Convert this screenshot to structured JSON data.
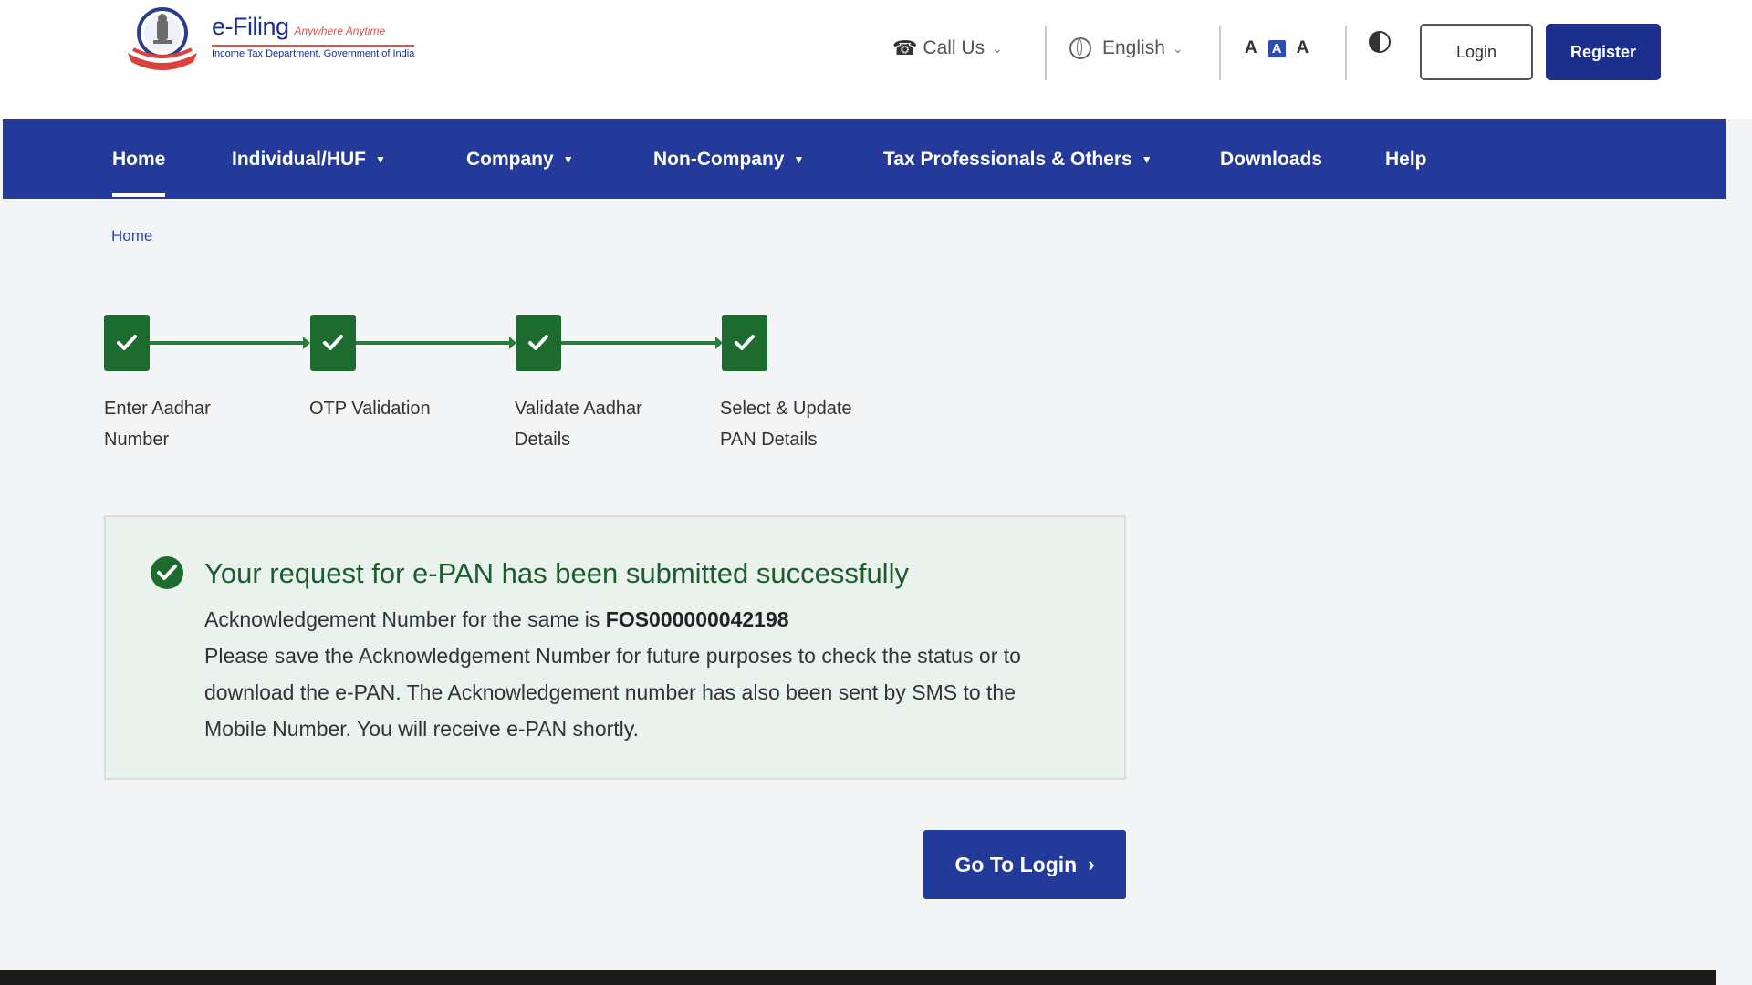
{
  "header": {
    "logo_title": "e-Filing",
    "logo_tagline": "Anywhere Anytime",
    "logo_subtitle": "Income Tax Department, Government of India",
    "call_us": "Call Us",
    "language": "English",
    "font_decrease": "A",
    "font_normal": "A",
    "font_increase": "A",
    "login_label": "Login",
    "register_label": "Register"
  },
  "nav": {
    "items": [
      {
        "label": "Home"
      },
      {
        "label": "Individual/HUF"
      },
      {
        "label": "Company"
      },
      {
        "label": "Non-Company"
      },
      {
        "label": "Tax Professionals & Others"
      },
      {
        "label": "Downloads"
      },
      {
        "label": "Help"
      }
    ]
  },
  "breadcrumb": {
    "home": "Home"
  },
  "stepper": {
    "steps": [
      {
        "line1": "Enter Aadhar",
        "line2": "Number",
        "completed": true
      },
      {
        "line1": "OTP Validation",
        "line2": "",
        "completed": true
      },
      {
        "line1": "Validate Aadhar",
        "line2": "Details",
        "completed": true
      },
      {
        "line1": "Select & Update",
        "line2": "PAN Details",
        "completed": true
      }
    ]
  },
  "success": {
    "title": "Your request for e-PAN has been submitted successfully",
    "ack_prefix": "Acknowledgement Number for the same is",
    "ack_number": "FOS000000042198",
    "message": "Please save the Acknowledgement Number for future purposes to check the status or to download the e-PAN. The Acknowledgement number has also been sent by SMS to the Mobile Number. You will receive e-PAN shortly."
  },
  "actions": {
    "go_to_login": "Go To Login"
  },
  "colors": {
    "primary": "#233a9b",
    "success_green": "#1d6b2e",
    "success_bg": "#e9f2ec"
  }
}
